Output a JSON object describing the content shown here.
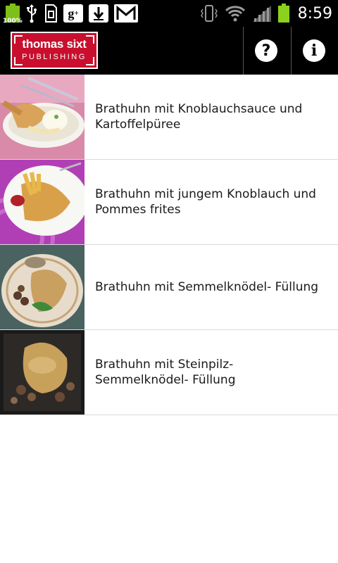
{
  "status_bar": {
    "battery_left_label": "100%",
    "time": "8:59",
    "icons": [
      "battery-icon",
      "usb-icon",
      "sd-card-icon",
      "google-plus-icon",
      "download-icon",
      "gmail-icon",
      "vibrate-icon",
      "wifi-icon",
      "signal-icon",
      "battery-icon"
    ]
  },
  "header": {
    "logo_line1": "thomas sixt",
    "logo_line2": "PUBLISHING",
    "help_glyph": "?",
    "info_glyph": "i"
  },
  "recipes": [
    {
      "title": "Brathuhn mit Knoblauchsauce und Kartoffelpüree"
    },
    {
      "title": "Brathuhn mit jungem Knoblauch und Pommes frites"
    },
    {
      "title": "Brathuhn mit Semmelknödel- Füllung"
    },
    {
      "title": "Brathuhn mit Steinpilz- Semmelknödel- Füllung"
    }
  ],
  "colors": {
    "brand_red": "#c8102e",
    "battery_green": "#8bd11d",
    "bar_black": "#000000"
  }
}
